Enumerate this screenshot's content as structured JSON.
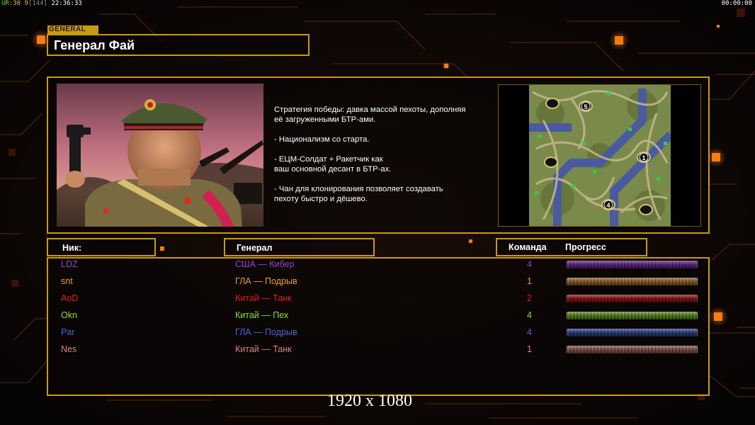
{
  "hud": {
    "left_prefix": "UR:",
    "left_a": "30",
    "left_b": "9",
    "left_c": "[144]",
    "time_left": "22:36:33",
    "time_right": "00:00:00"
  },
  "general_tag": "GENERAL",
  "general_name": "Генерал Фай",
  "description": [
    "Стратегия победы: давка массой пехоты, дополняя\n её загруженными БТР-ами.",
    "- Национализм со старта.",
    "- ЕЦМ-Солдат + Ракетчик как\nваш основной десант в БТР-ах.",
    "- Чан для клонирования позволяет создавать\n пехоту быстро и дёшево."
  ],
  "map": {
    "start_markers": [
      "5",
      "1",
      "4"
    ]
  },
  "headers": {
    "nick": "Ник:",
    "general": "Генерал",
    "team": "Команда",
    "progress": "Прогресс"
  },
  "players": [
    {
      "nick": "LDZ",
      "general": "США — Кибер",
      "team": "4",
      "color": "#9a3fd6",
      "progress": 1.0
    },
    {
      "nick": "snt",
      "general": "ГЛА — Подрыв",
      "team": "1",
      "color": "#e8a040",
      "progress": 1.0
    },
    {
      "nick": "AoD",
      "general": "Китай — Танк",
      "team": "2",
      "color": "#e02020",
      "progress": 1.0
    },
    {
      "nick": "Okn",
      "general": "Китай — Пех",
      "team": "4",
      "color": "#8ee030",
      "progress": 1.0
    },
    {
      "nick": "Par",
      "general": "ГЛА — Подрыв",
      "team": "4",
      "color": "#4a66e0",
      "progress": 1.0
    },
    {
      "nick": "Nes",
      "general": "Китай — Танк",
      "team": "1",
      "color": "#d88878",
      "progress": 1.0
    }
  ],
  "colors": {
    "frame": "#c89a14",
    "background": "#0b0706",
    "accent_square": "#ff7a10"
  },
  "resolution_label": "1920 x 1080"
}
